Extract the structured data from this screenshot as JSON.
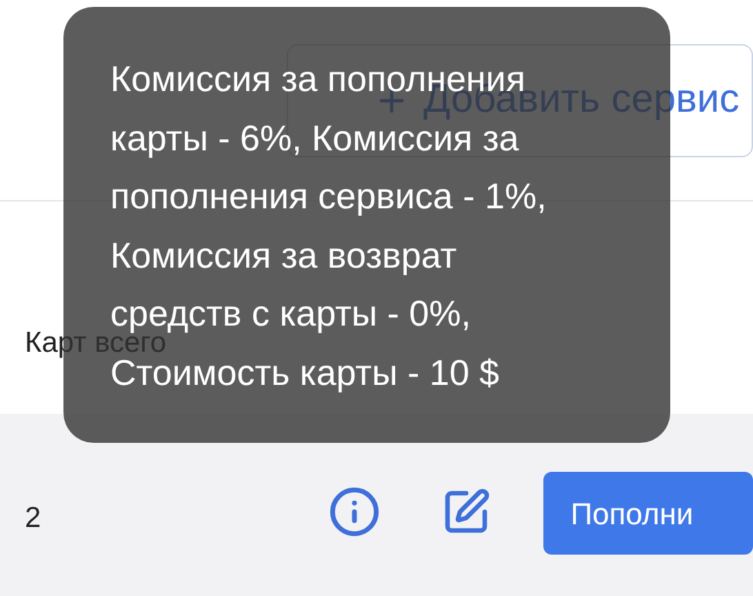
{
  "add_service_button": {
    "label": "Добавить сервис"
  },
  "cards_total": {
    "label": "Карт всего",
    "value": "2"
  },
  "row_actions": {
    "top_up_button": "Пополни"
  },
  "tooltip": {
    "text": "Комиссия за пополнения карты - 6%, Комиссия за пополнения сервиса - 1%, Комиссия за возврат средств с карты - 0%, Стоимость карты - 10 $"
  }
}
